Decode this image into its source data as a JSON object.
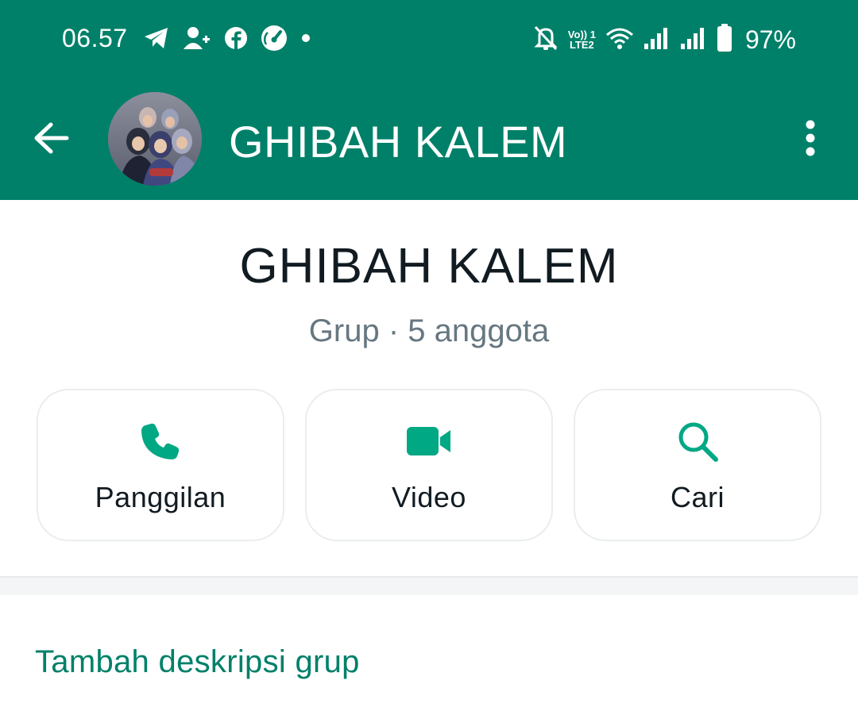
{
  "status_bar": {
    "time": "06.57",
    "battery_percent": "97%",
    "network_line1": "Vo)) 1",
    "network_line2": "LTE2",
    "left_icons": [
      "telegram-icon",
      "add-contact-icon",
      "facebook-icon",
      "speedometer-icon",
      "dot-icon"
    ],
    "right_icons": [
      "notifications-off-icon",
      "volte-icon",
      "wifi-icon",
      "signal-icon",
      "signal-icon",
      "battery-icon"
    ]
  },
  "appbar": {
    "title": "GHIBAH KALEM",
    "back_icon": "arrow-left-icon",
    "more_icon": "more-vertical-icon"
  },
  "header": {
    "group_name": "GHIBAH KALEM",
    "subtitle": "Grup · 5 anggota"
  },
  "actions": [
    {
      "label": "Panggilan",
      "icon": "phone-icon"
    },
    {
      "label": "Video",
      "icon": "video-camera-icon"
    },
    {
      "label": "Cari",
      "icon": "search-icon"
    }
  ],
  "description": {
    "add_label": "Tambah deskripsi grup"
  },
  "colors": {
    "brand_green": "#008069",
    "accent_green": "#00a884",
    "text_primary": "#111b21",
    "text_secondary": "#667781",
    "card_border": "#e9edef"
  }
}
